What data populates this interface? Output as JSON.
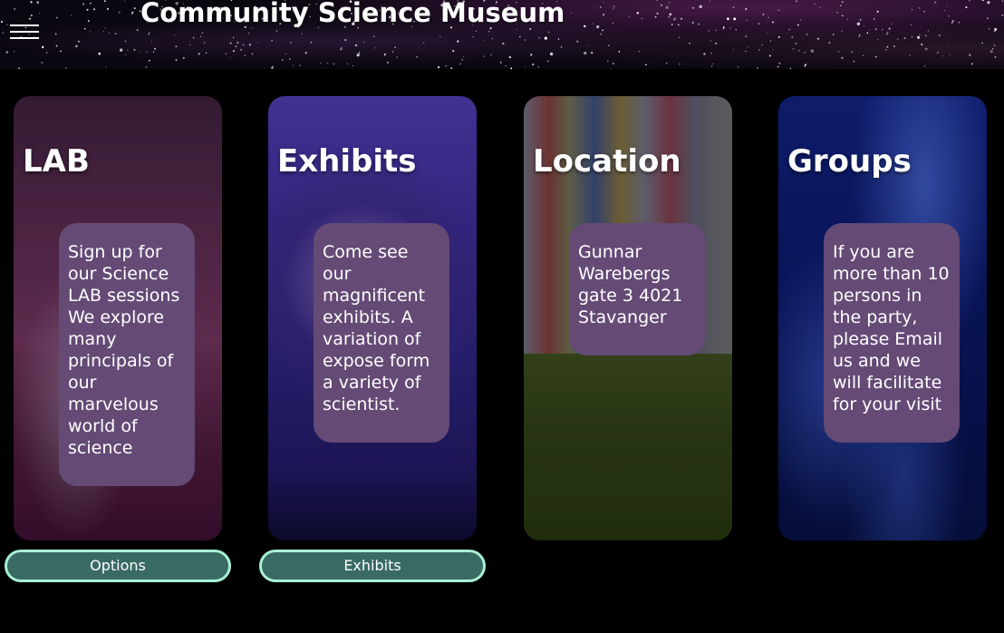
{
  "header": {
    "title": "Community Science Museum",
    "menu_icon": "hamburger-icon"
  },
  "cards": [
    {
      "title": "LAB",
      "text": "Sign up for our Science LAB sessions We explore many principals of our marvelous world of science",
      "button": "Options"
    },
    {
      "title": "Exhibits",
      "text": "Come see our magnificent exhibits. A variation of expose form a variety of scientist.",
      "button": "Exhibits"
    },
    {
      "title": "Location",
      "text": "Gunnar Warebergs gate 3 4021 Stavanger"
    },
    {
      "title": "Groups",
      "text": "If you are more than 10 persons in the party, please Email us and we will facilitate for your visit"
    }
  ],
  "colors": {
    "background": "#000000",
    "text_box": "#644a75",
    "button_fill": "#3a6a64",
    "button_border": "#a8f0d4"
  }
}
